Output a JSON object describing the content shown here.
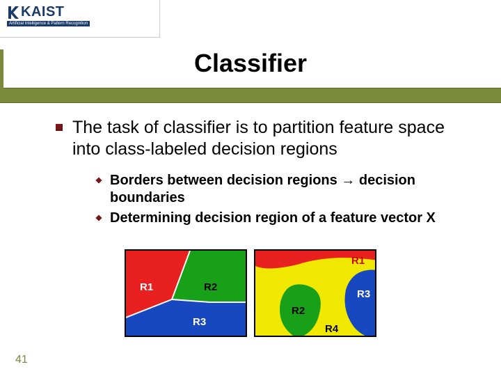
{
  "logo": {
    "name": "KAIST",
    "subtitle": "Artificial Intelligence & Pattern Recognition"
  },
  "title": "Classifier",
  "bullets": {
    "main": "The task of classifier is to partition feature space into class-labeled decision regions",
    "sub1": "Borders between decision regions → decision boundaries",
    "sub2": "Determining decision region of a feature vector X"
  },
  "figure1": {
    "labels": {
      "r1": "R1",
      "r2": "R2",
      "r3": "R3"
    },
    "colors": {
      "r1": "#e82020",
      "r2": "#18a018",
      "r3": "#1848c0"
    }
  },
  "figure2": {
    "labels": {
      "r1": "R1",
      "r2": "R2",
      "r3": "R3",
      "r4": "R4"
    },
    "colors": {
      "r1": "#e82020",
      "r2": "#18a018",
      "r3": "#1848c0",
      "bg": "#f0e800"
    }
  },
  "pageNumber": "41"
}
